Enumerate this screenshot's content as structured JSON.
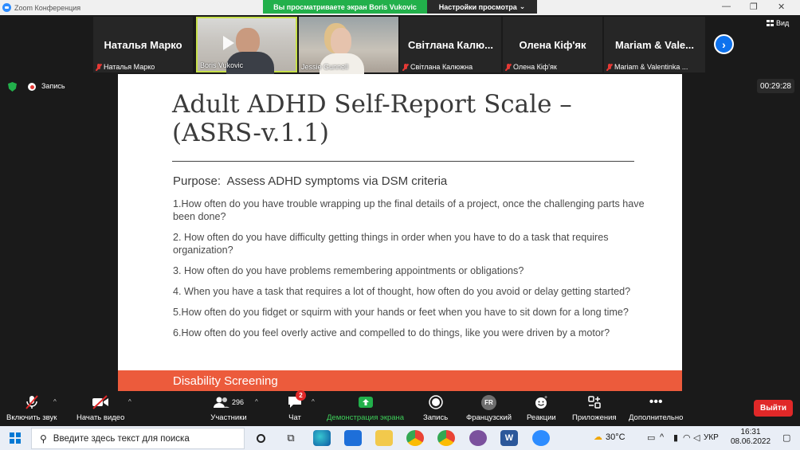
{
  "window": {
    "title": "Zoom Конференция"
  },
  "banner": {
    "sharing_text": "Вы просматриваете экран Boris Vukovic",
    "view_options": "Настройки просмотра"
  },
  "participants": [
    {
      "display": "Наталья Марко",
      "caption": "Наталья Марко",
      "video": false
    },
    {
      "display": "",
      "caption": "Boris Vukovic",
      "video": true
    },
    {
      "display": "",
      "caption": "Jessie Gunnell",
      "video": true
    },
    {
      "display": "Світлана  Калю...",
      "caption": "Світлана Калюжна",
      "video": false
    },
    {
      "display": "Олена Кіф'як",
      "caption": "Олена Кіф'як",
      "video": false
    },
    {
      "display": "Mariam  &  Vale...",
      "caption": "Mariam & Valentinka ...",
      "video": false
    }
  ],
  "view_button": "Вид",
  "recording": {
    "label": "Запись",
    "timer": "00:29:28"
  },
  "slide": {
    "title_line1": "Adult ADHD Self-Report Scale –",
    "title_line2": "(ASRS-v.1.1)",
    "purpose_label": "Purpose:",
    "purpose_text": "Assess ADHD symptoms via DSM criteria",
    "questions": [
      "1.How often do you have trouble wrapping up the final details of a project, once the challenging parts have been done?",
      "2. How often do you have difficulty getting things in order when you have to do a task that requires organization?",
      "3. How often do you have problems remembering appointments or obligations?",
      "4. When you have a task that requires a lot of thought, how often do you avoid or delay getting started?",
      "5.How often do you fidget or squirm with your hands or feet when you have to sit down for a long time?",
      "6.How often do you feel overly active and compelled to do things, like you were driven by a motor?"
    ],
    "footer": "Disability Screening"
  },
  "toolbar": {
    "audio": "Включить звук",
    "video": "Начать видео",
    "participants": "Участники",
    "participants_count": "296",
    "chat": "Чат",
    "chat_badge": "2",
    "share": "Демонстрация экрана",
    "record": "Запись",
    "interpretation": "Французский",
    "interpretation_code": "FR",
    "reactions": "Реакции",
    "apps": "Приложения",
    "more": "Дополнительно",
    "leave": "Выйти"
  },
  "taskbar": {
    "search_placeholder": "Введите здесь текст для поиска",
    "temperature": "30°C",
    "language": "УКР",
    "time": "16:31",
    "date": "08.06.2022"
  },
  "colors": {
    "share_green": "#22b04b",
    "slide_band": "#ec5b3c",
    "zoom_blue": "#0e72ed",
    "leave_red": "#e02828"
  }
}
